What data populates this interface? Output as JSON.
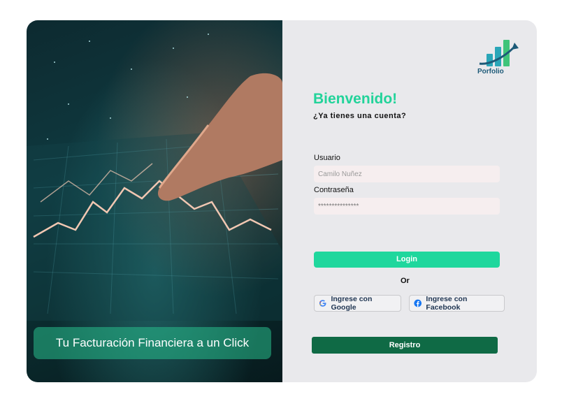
{
  "hero": {
    "tagline": "Tu Facturación Financiera a un Click"
  },
  "logo": {
    "name": "Porfolio"
  },
  "login": {
    "title": "Bienvenido!",
    "subtitle": "¿Ya tienes una cuenta?",
    "user_label": "Usuario",
    "user_placeholder": "Camilo Nuñez",
    "password_label": "Contraseña",
    "password_value": "***************",
    "login_button": "Login",
    "or_text": "Or",
    "google_button": "Ingrese con Google",
    "facebook_button": "Ingrese con Facebook",
    "register_button": "Registro"
  },
  "colors": {
    "accent": "#22d39a",
    "register": "#0f6a45",
    "facebook": "#1877f2"
  },
  "icons": {
    "google": "google-icon",
    "facebook": "facebook-icon",
    "logo": "bar-chart-logo-icon"
  }
}
